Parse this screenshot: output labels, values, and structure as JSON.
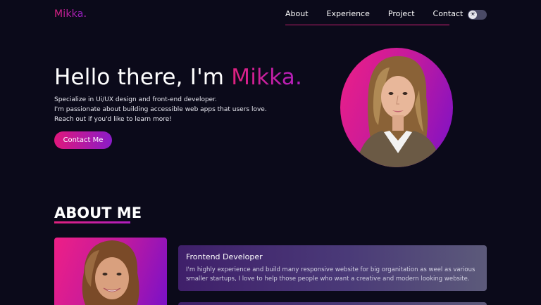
{
  "nav": {
    "logo": "Mikka",
    "logo_dot": ".",
    "links": [
      "About",
      "Experience",
      "Project",
      "Contact"
    ],
    "theme_toggle": "sun-moon-toggle"
  },
  "hero": {
    "greeting": "Hello there, I'm ",
    "name": "Mikka.",
    "lines": [
      "Specialize in Ui/UX design and front-end developer.",
      "I'm passionate about building accessible web apps that users love.",
      "Reach out if you'd like to learn more!"
    ],
    "cta": "Contact Me"
  },
  "about": {
    "title": "ABOUT ME",
    "card": {
      "title": "Frontend Developer",
      "body": "I'm highly experience and build many responsive website for big organitation as weel as various smaller startups, I love to help those people who want a creative and modern looking website."
    }
  },
  "colors": {
    "background": "#0b0a1a",
    "accent_pink": "#e0217e",
    "accent_purple": "#8b1fd0"
  }
}
